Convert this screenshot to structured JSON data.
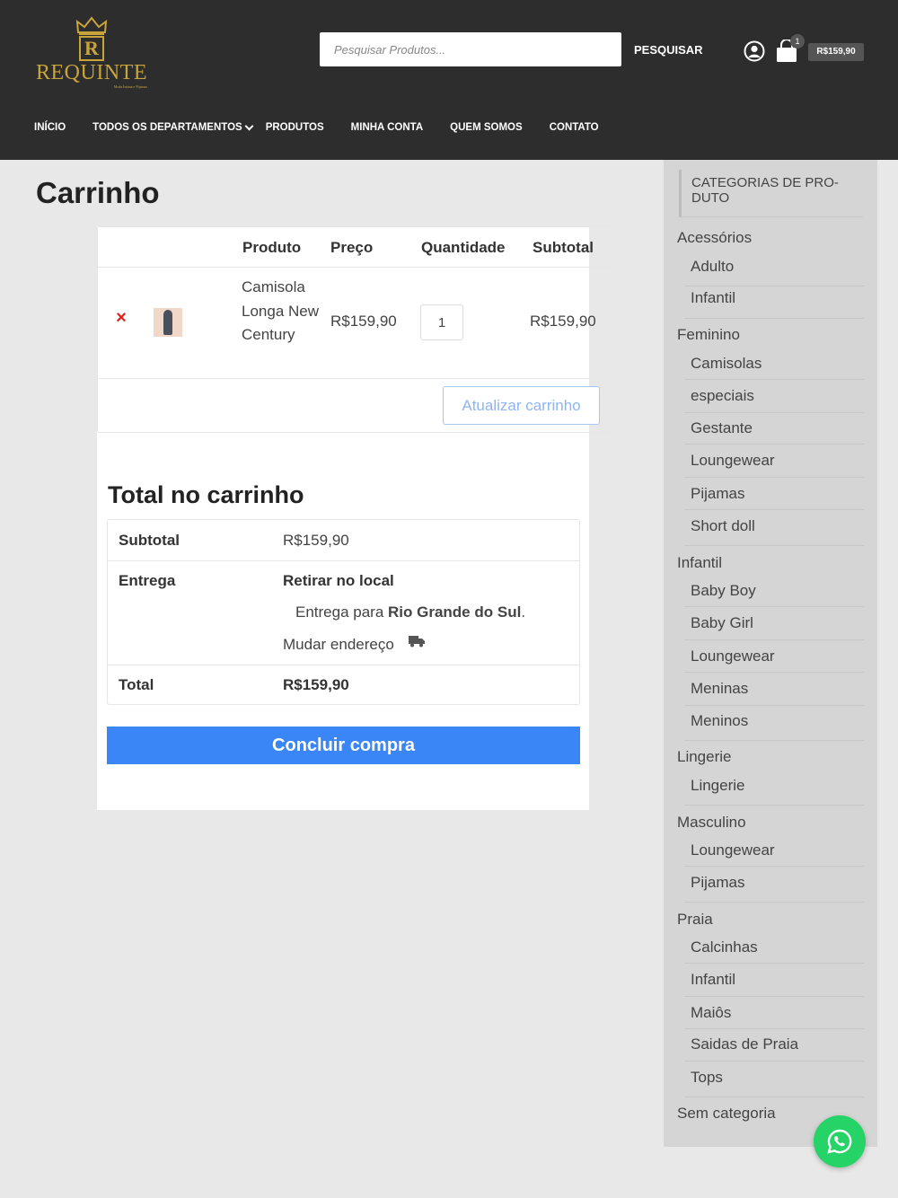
{
  "header": {
    "logo": {
      "name": "REQUINTE",
      "letter": "R",
      "tagline": "Moda Íntima e Pijamas"
    },
    "search": {
      "placeholder": "Pesquisar Produtos...",
      "button_label": "PESQUISAR"
    },
    "cart": {
      "count": "1",
      "total": "R$159,90"
    },
    "nav": [
      {
        "label": "INÍCIO"
      },
      {
        "label": "TODOS OS DEPARTAMENTOS",
        "has_dropdown": true
      },
      {
        "label": "PRODUTOS"
      },
      {
        "label": "MINHA CONTA"
      },
      {
        "label": "QUEM SOMOS"
      },
      {
        "label": "CONTATO"
      }
    ]
  },
  "page": {
    "title": "Carrinho"
  },
  "cart_table": {
    "columns": [
      "Produto",
      "Preço",
      "Quantidade",
      "Subtotal"
    ],
    "items": [
      {
        "name": "Camisola Longa New Century",
        "price": "R$159,90",
        "quantity": "1",
        "subtotal": "R$159,90"
      }
    ],
    "update_button": "Atualizar carrinho"
  },
  "totals": {
    "title": "Total no carrinho",
    "subtotal_label": "Subtotal",
    "subtotal_value": "R$159,90",
    "shipping_label": "Entrega",
    "shipping_method": "Retirar no local",
    "shipping_prefix": "Entrega para ",
    "shipping_destination": "Rio Grande do Sul",
    "shipping_suffix": ".",
    "change_address": "Mudar endereço",
    "total_label": "Total",
    "total_value": "R$159,90",
    "checkout_button": "Concluir compra"
  },
  "sidebar": {
    "title": "CATEGORIAS DE PRO-DUTO",
    "categories": [
      {
        "label": "Acessórios",
        "children": [
          "Adulto",
          "Infantil"
        ]
      },
      {
        "label": "Feminino",
        "children": [
          "Camisolas",
          "especiais",
          "Gestante",
          "Loungewear",
          "Pijamas",
          "Short doll"
        ]
      },
      {
        "label": "Infantil",
        "children": [
          "Baby Boy",
          "Baby Girl",
          "Loungewear",
          "Meninas",
          "Meninos"
        ]
      },
      {
        "label": "Lingerie",
        "children": [
          "Lingerie"
        ]
      },
      {
        "label": "Masculino",
        "children": [
          "Loungewear",
          "Pijamas"
        ]
      },
      {
        "label": "Praia",
        "children": [
          "Calcinhas",
          "Infantil",
          "Maiôs",
          "Saidas de Praia",
          "Tops"
        ]
      },
      {
        "label": "Sem categoria",
        "children": []
      }
    ]
  },
  "icons": {
    "account": "user-circle-icon",
    "cart": "shopping-bag-icon",
    "remove": "close-icon",
    "truck": "truck-icon",
    "whatsapp": "whatsapp-icon"
  },
  "colors": {
    "header_bg": "#2d2d2d",
    "brand_gold": "#c9a43a",
    "checkout_blue": "#3a86f7",
    "remove_red": "#e2231a",
    "whatsapp_green": "#25d366"
  }
}
